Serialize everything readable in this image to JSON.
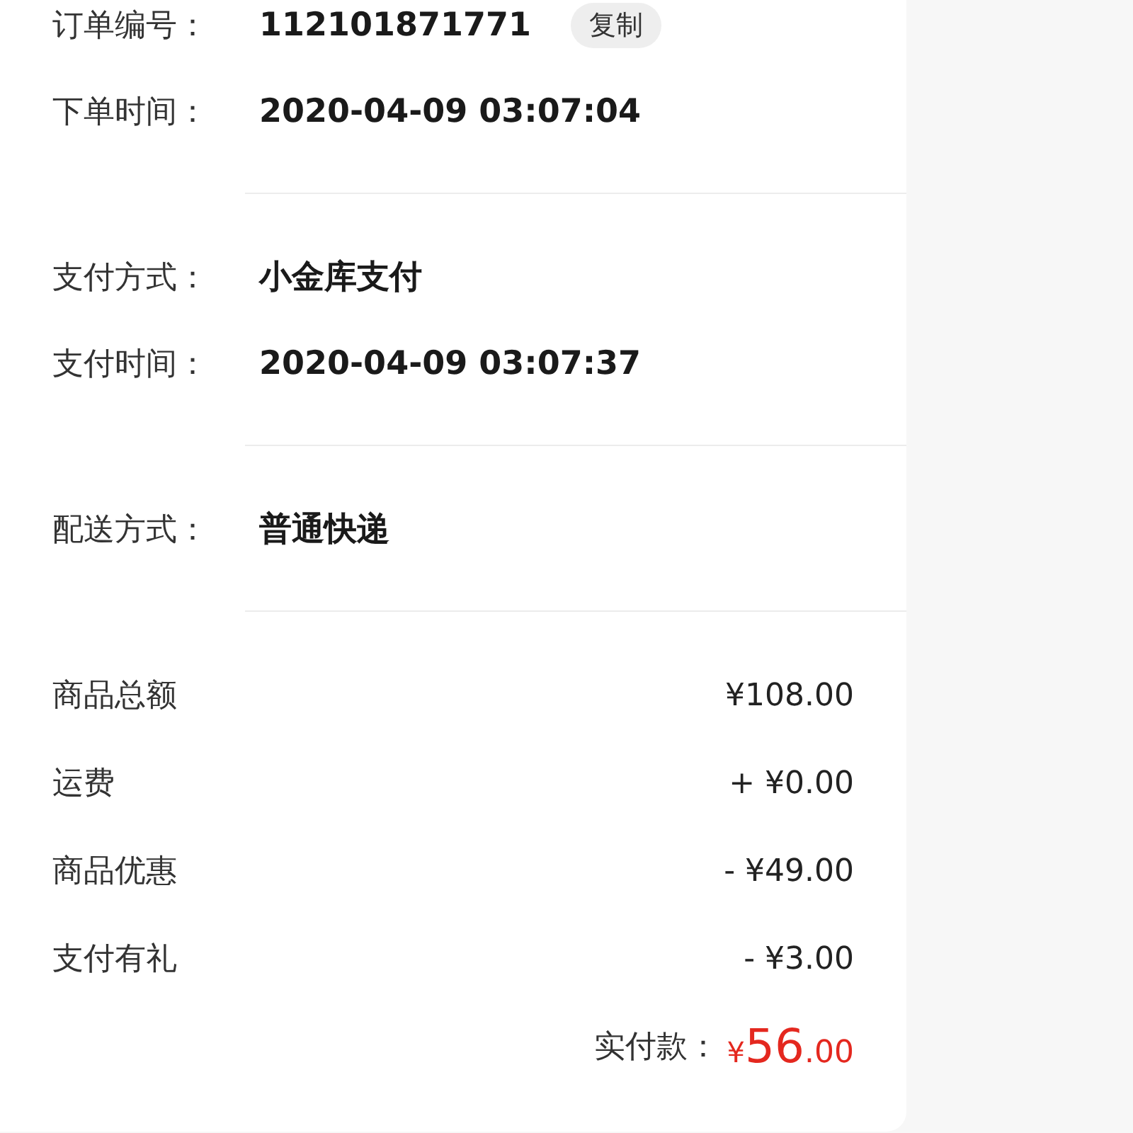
{
  "sections": [
    {
      "rows": [
        {
          "label": "订单编号：",
          "value": "112101871771",
          "action": "复制"
        },
        {
          "label": "下单时间：",
          "value": "2020-04-09 03:07:04"
        }
      ]
    },
    {
      "rows": [
        {
          "label": "支付方式：",
          "value": "小金库支付"
        },
        {
          "label": "支付时间：",
          "value": "2020-04-09 03:07:37"
        }
      ]
    },
    {
      "rows": [
        {
          "label": "配送方式：",
          "value": "普通快递"
        }
      ]
    }
  ],
  "amounts": [
    {
      "label": "商品总额",
      "value": "¥108.00"
    },
    {
      "label": "运费",
      "value": "+ ¥0.00"
    },
    {
      "label": "商品优惠",
      "value": "- ¥49.00"
    },
    {
      "label": "支付有礼",
      "value": "- ¥3.00"
    }
  ],
  "total": {
    "label": "实付款：",
    "currency": "¥",
    "integer": "56",
    "decimals": ".00"
  }
}
